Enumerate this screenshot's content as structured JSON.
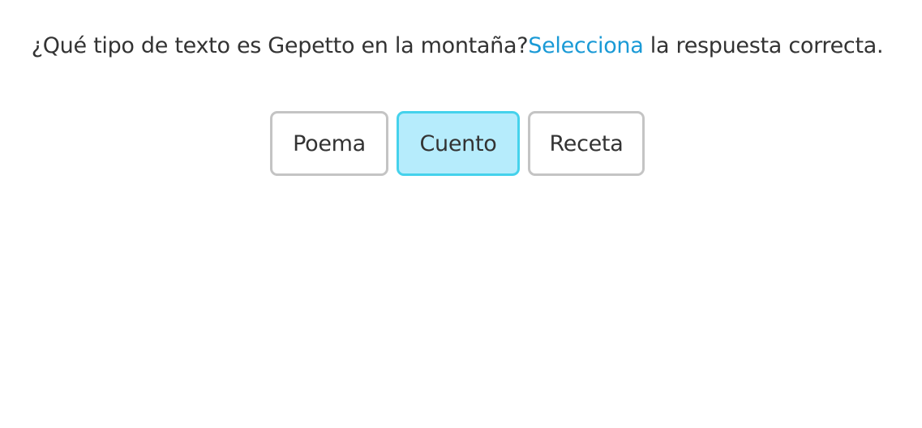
{
  "question": {
    "text_before": "¿Qué tipo de texto es Gepetto en la montaña?",
    "link_text": "Selecciona",
    "text_after": " la respuesta correcta."
  },
  "options": [
    {
      "label": "Poema",
      "selected": false
    },
    {
      "label": "Cuento",
      "selected": true
    },
    {
      "label": "Receta",
      "selected": false
    }
  ],
  "colors": {
    "text": "#333333",
    "link": "#1a9ad6",
    "border": "#c4c4c4",
    "selected_bg": "#b6ecfc",
    "selected_border": "#45d2ec"
  }
}
